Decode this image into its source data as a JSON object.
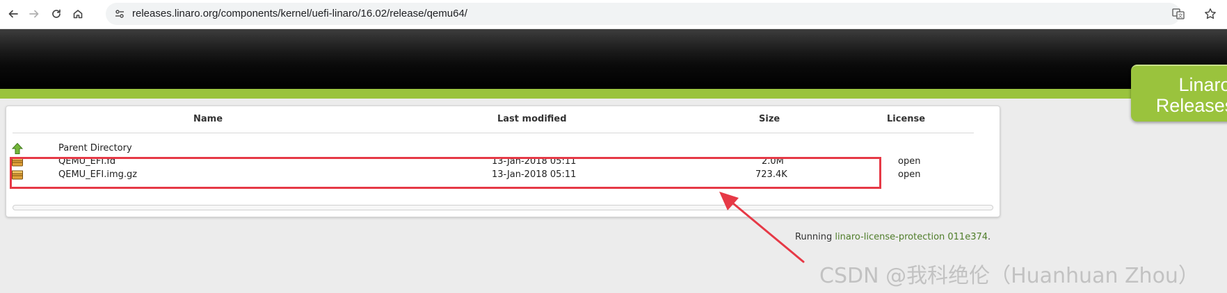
{
  "browser": {
    "url": "releases.linaro.org/components/kernel/uefi-linaro/16.02/release/qemu64/"
  },
  "header": {
    "brand_line1": "Linaro",
    "brand_line2": "Releases"
  },
  "table": {
    "columns": [
      "Name",
      "Last modified",
      "Size",
      "License"
    ],
    "parent": {
      "name": "Parent Directory",
      "icon": "up-arrow-icon"
    },
    "rows": [
      {
        "name": "QEMU_EFI.fd",
        "modified": "13-Jan-2018 05:11",
        "size": "2.0M",
        "license": "open",
        "icon": "file-icon"
      },
      {
        "name": "QEMU_EFI.img.gz",
        "modified": "13-Jan-2018 05:11",
        "size": "723.4K",
        "license": "open",
        "icon": "file-icon"
      }
    ]
  },
  "footer": {
    "prefix": "Running ",
    "link": "linaro-license-protection 011e374",
    "suffix": "."
  },
  "watermark": "CSDN @我科绝伦（Huanhuan Zhou）",
  "colors": {
    "accent_green": "#9ac33d",
    "highlight_red": "#e63946",
    "link_green": "#4f7d2a"
  }
}
